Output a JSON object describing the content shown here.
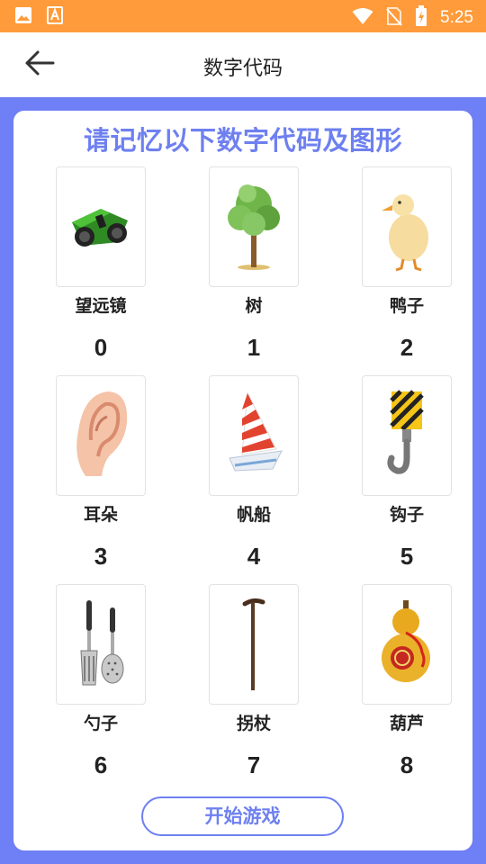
{
  "status_bar": {
    "time": "5:25",
    "icons": [
      "image-icon",
      "a-badge-icon",
      "wifi-icon",
      "no-sim-icon",
      "battery-charging-icon"
    ]
  },
  "app_bar": {
    "back_icon": "arrow-left-icon",
    "title": "数字代码"
  },
  "card": {
    "title": "请记忆以下数字代码及图形",
    "items": [
      {
        "name": "望远镜",
        "code": "0",
        "icon": "binoculars-icon"
      },
      {
        "name": "树",
        "code": "1",
        "icon": "tree-icon"
      },
      {
        "name": "鸭子",
        "code": "2",
        "icon": "duck-icon"
      },
      {
        "name": "耳朵",
        "code": "3",
        "icon": "ear-icon"
      },
      {
        "name": "帆船",
        "code": "4",
        "icon": "sailboat-icon"
      },
      {
        "name": "钩子",
        "code": "5",
        "icon": "hook-icon"
      },
      {
        "name": "勺子",
        "code": "6",
        "icon": "spoon-icon"
      },
      {
        "name": "拐杖",
        "code": "7",
        "icon": "cane-icon"
      },
      {
        "name": "葫芦",
        "code": "8",
        "icon": "gourd-icon"
      }
    ],
    "start_button": "开始游戏"
  },
  "colors": {
    "status_bar": "#ff9b3a",
    "background": "#6f7ff5",
    "accent": "#6e80f0"
  }
}
